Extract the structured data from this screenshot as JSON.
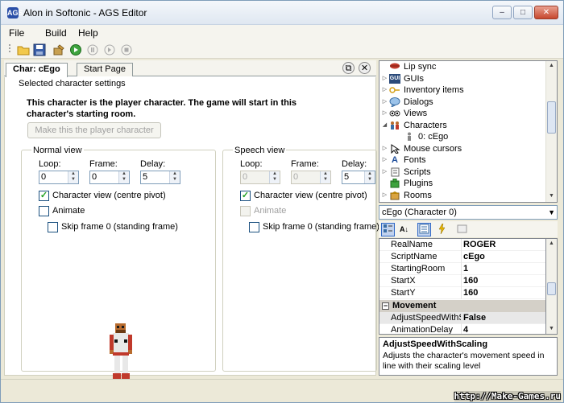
{
  "window": {
    "title": "Alon in Softonic - AGS Editor",
    "app_icon": "AGS",
    "minimize": "–",
    "maximize": "□",
    "close": "✕"
  },
  "menu": [
    "File",
    "Build",
    "Help"
  ],
  "toolbar": {
    "icons": [
      "open-folder-icon",
      "save-icon",
      "build-icon",
      "run-icon",
      "pause-icon",
      "step-icon",
      "stop-icon"
    ]
  },
  "tabs": [
    {
      "label": "Char: cEgo",
      "active": true
    },
    {
      "label": "Start Page",
      "active": false
    }
  ],
  "tab_controls": {
    "float": "⧉",
    "close": "✕"
  },
  "editor": {
    "section_title": "Selected character settings",
    "player_message": "This character is the player character. The game will start in this character's starting room.",
    "make_player_button": "Make this the player character",
    "normal_view": {
      "title": "Normal view",
      "loop_label": "Loop:",
      "frame_label": "Frame:",
      "delay_label": "Delay:",
      "loop": "0",
      "frame": "0",
      "delay": "5",
      "character_view_label": "Character view (centre pivot)",
      "character_view_checked": true,
      "animate_label": "Animate",
      "animate_checked": false,
      "skip_frame_label": "Skip frame 0 (standing frame)",
      "skip_frame_checked": false
    },
    "speech_view": {
      "title": "Speech view",
      "loop_label": "Loop:",
      "frame_label": "Frame:",
      "delay_label": "Delay:",
      "loop": "0",
      "frame": "0",
      "delay": "5",
      "character_view_label": "Character view (centre pivot)",
      "character_view_checked": true,
      "animate_label": "Animate",
      "animate_checked": false,
      "skip_frame_label": "Skip frame 0 (standing frame)",
      "skip_frame_checked": false
    }
  },
  "tree": {
    "items": [
      {
        "label": "Lip sync",
        "icon": "lips-icon"
      },
      {
        "label": "GUIs",
        "icon": "gui-icon",
        "icon_text": "GUI"
      },
      {
        "label": "Inventory items",
        "icon": "key-icon"
      },
      {
        "label": "Dialogs",
        "icon": "speech-bubble-icon"
      },
      {
        "label": "Views",
        "icon": "eyes-icon"
      },
      {
        "label": "Characters",
        "icon": "people-icon"
      },
      {
        "label": "0: cEgo",
        "icon": "person-icon"
      },
      {
        "label": "Mouse cursors",
        "icon": "cursor-icon"
      },
      {
        "label": "Fonts",
        "icon": "font-icon"
      },
      {
        "label": "Scripts",
        "icon": "script-icon"
      },
      {
        "label": "Plugins",
        "icon": "plugin-icon"
      },
      {
        "label": "Rooms",
        "icon": "rooms-icon"
      }
    ]
  },
  "properties": {
    "selected_object": "cEgo (Character 0)",
    "rows": [
      {
        "name": "RealName",
        "value": "ROGER"
      },
      {
        "name": "ScriptName",
        "value": "cEgo"
      },
      {
        "name": "StartingRoom",
        "value": "1"
      },
      {
        "name": "StartX",
        "value": "160"
      },
      {
        "name": "StartY",
        "value": "160"
      }
    ],
    "category": "Movement",
    "category_rows": [
      {
        "name": "AdjustSpeedWithSc",
        "value": "False"
      },
      {
        "name": "AnimationDelay",
        "value": "4"
      }
    ],
    "description_title": "AdjustSpeedWithScaling",
    "description_text": "Adjusts the character's movement speed in line with their scaling level"
  },
  "watermark": "http://Make-Games.ru",
  "colors": {
    "accent": "#3169c6",
    "window_border": "#7f9db9",
    "category_bg": "#d4d0c8"
  }
}
